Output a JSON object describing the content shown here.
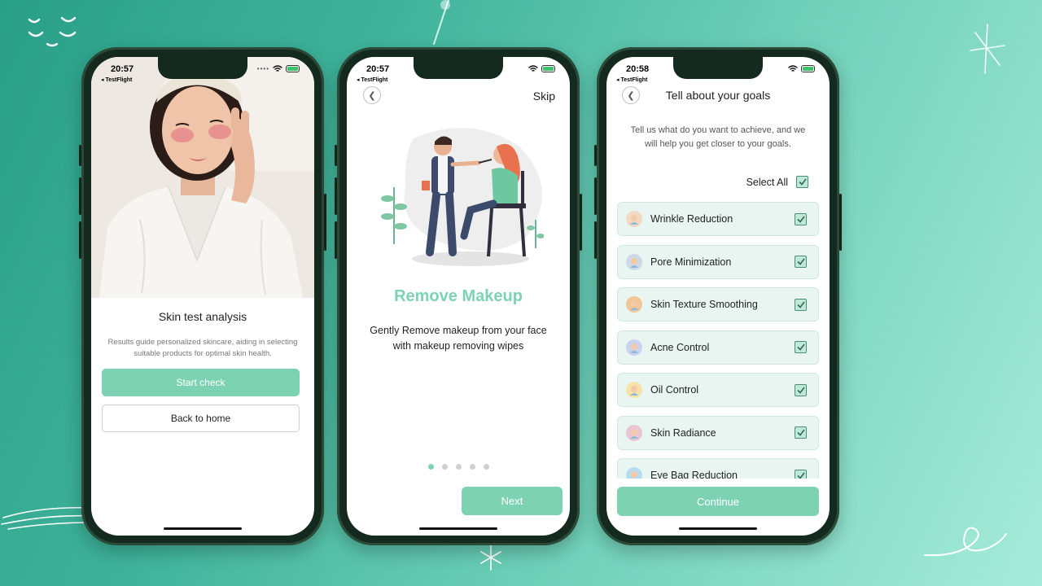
{
  "brand": {
    "accent": "#7dd3b1",
    "check_border": "#4c8c78"
  },
  "phone1": {
    "status": {
      "time": "20:57",
      "source": "◂ TestFlight"
    },
    "title": "Skin test analysis",
    "description": "Results guide personalized skincare, aiding in selecting suitable products for optimal skin health.",
    "start_label": "Start check",
    "back_label": "Back to home"
  },
  "phone2": {
    "status": {
      "time": "20:57",
      "source": "◂ TestFlight"
    },
    "back_icon": "chevron-left-icon",
    "skip_label": "Skip",
    "heading": "Remove Makeup",
    "description": "Gently Remove makeup from your face with makeup removing wipes",
    "pager": {
      "total": 5,
      "active": 0
    },
    "next_label": "Next"
  },
  "phone3": {
    "status": {
      "time": "20:58",
      "source": "◂ TestFlight"
    },
    "back_icon": "chevron-left-icon",
    "title": "Tell about your goals",
    "description": "Tell us what do you want to achieve, and we will help you get closer to your goals.",
    "select_all_label": "Select All",
    "select_all_checked": true,
    "goals": [
      {
        "label": "Wrinkle Reduction",
        "icon": "face-wrinkle-icon",
        "checked": true,
        "color": "#f3d9c4"
      },
      {
        "label": "Pore Minimization",
        "icon": "face-pore-icon",
        "checked": true,
        "color": "#cfd9e6"
      },
      {
        "label": "Skin Texture Smoothing",
        "icon": "face-smooth-icon",
        "checked": true,
        "color": "#f1c79a"
      },
      {
        "label": "Acne Control",
        "icon": "face-acne-icon",
        "checked": true,
        "color": "#c9d3ef"
      },
      {
        "label": "Oil Control",
        "icon": "oil-bottle-icon",
        "checked": true,
        "color": "#f7e3a8"
      },
      {
        "label": "Skin Radiance",
        "icon": "face-radiance-icon",
        "checked": true,
        "color": "#eac5d3"
      },
      {
        "label": "Eye Bag Reduction",
        "icon": "face-eyebag-icon",
        "checked": true,
        "color": "#b9dbef"
      }
    ],
    "continue_label": "Continue"
  }
}
